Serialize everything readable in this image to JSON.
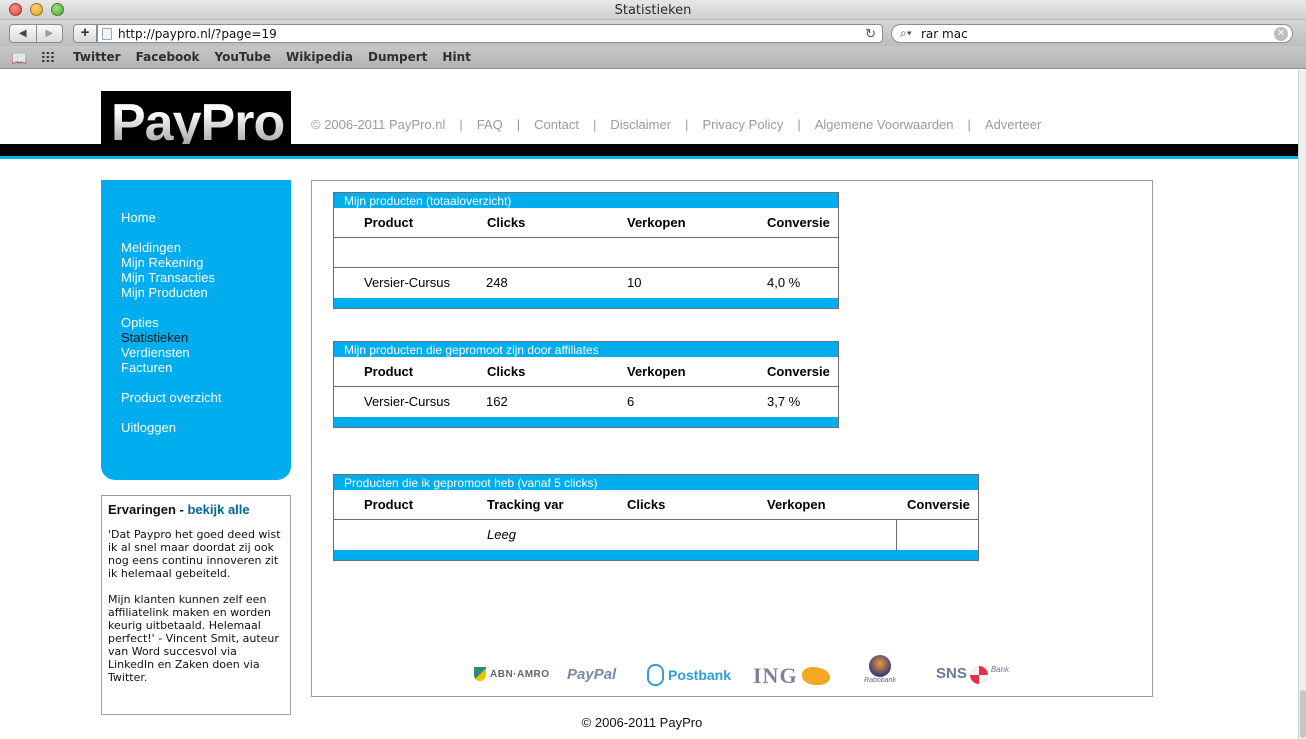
{
  "window": {
    "title": "Statistieken"
  },
  "browser": {
    "url": "http://paypro.nl/?page=19",
    "search": "rar mac",
    "bookmarks": [
      "Twitter",
      "Facebook",
      "YouTube",
      "Wikipedia",
      "Dumpert",
      "Hint"
    ]
  },
  "header": {
    "logo_text": "PayPro",
    "nav": [
      "© 2006-2011 PayPro.nl",
      "FAQ",
      "Contact",
      "Disclaimer",
      "Privacy Policy",
      "Algemene Voorwaarden",
      "Adverteer"
    ]
  },
  "sidebar": {
    "groups": [
      [
        "Home"
      ],
      [
        "Meldingen",
        "Mijn Rekening",
        "Mijn Transacties",
        "Mijn Producten"
      ],
      [
        "Opties",
        "Statistieken",
        "Verdiensten",
        "Facturen"
      ],
      [
        "Product overzicht"
      ],
      [
        "Uitloggen"
      ]
    ],
    "active": "Statistieken"
  },
  "review": {
    "title": "Ervaringen",
    "dash": " - ",
    "link": "bekijk alle",
    "paragraphs": [
      "'Dat Paypro het goed deed wist ik al snel maar doordat zij ook nog eens continu innoveren zit ik helemaal gebeiteld.",
      "Mijn klanten kunnen zelf een affiliatelink maken en worden keurig uitbetaald. Helemaal perfect!' - Vincent Smit, auteur van Word succesvol via LinkedIn en Zaken doen via Twitter."
    ]
  },
  "tables": {
    "own_products": {
      "caption": "Mijn producten (totaaloverzicht)",
      "headers": [
        "Product",
        "Clicks",
        "Verkopen",
        "Conversie"
      ],
      "rows": [
        [
          "Versier-Cursus",
          "248",
          "10",
          "4,0 %"
        ]
      ]
    },
    "promoted_by_affiliates": {
      "caption": "Mijn producten die gepromoot zijn door affiliates",
      "headers": [
        "Product",
        "Clicks",
        "Verkopen",
        "Conversie"
      ],
      "rows": [
        [
          "Versier-Cursus",
          "162",
          "6",
          "3,7 %"
        ]
      ]
    },
    "i_promote": {
      "caption": "Producten die ik gepromoot heb (vanaf 5 clicks)",
      "headers": [
        "Product",
        "Tracking var",
        "Clicks",
        "Verkopen",
        "Conversie"
      ],
      "empty_text": "Leeg"
    }
  },
  "payment_logos": {
    "abn": "ABN·AMRO",
    "paypal": "PayPal",
    "postbank": "Postbank",
    "ing": "ING",
    "rabobank": "Rabobank",
    "sns": "SNS",
    "sns_bank": "Bank"
  },
  "footer": {
    "copyright": "© 2006-2011 PayPro"
  },
  "icons": [
    "back-icon",
    "forward-icon",
    "add-bookmark-icon",
    "reload-icon",
    "search-icon",
    "clear-icon",
    "bookmarks-book-icon",
    "top-sites-grid-icon"
  ]
}
